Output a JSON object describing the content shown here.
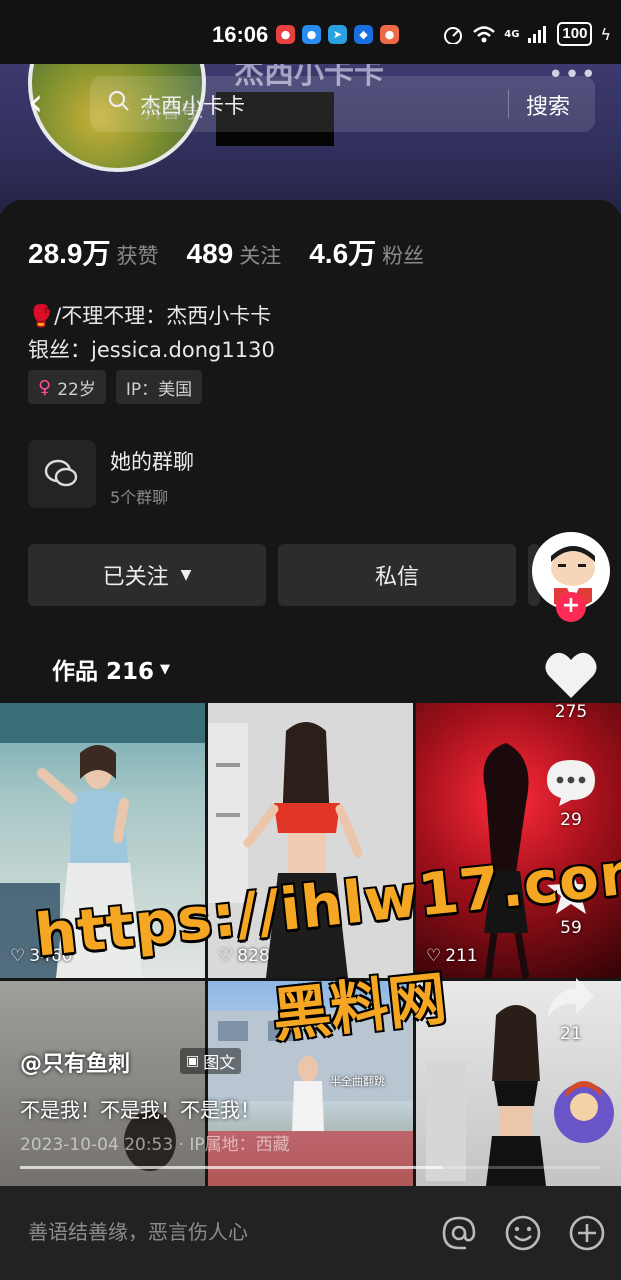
{
  "status": {
    "time": "16:06",
    "network": "4G",
    "battery": "100"
  },
  "header": {
    "profile_name": "杰西小卡卡",
    "search_text": "杰西小卡卡",
    "douyin_id_label": "抖音号:",
    "search_button": "搜索"
  },
  "stats": [
    {
      "value": "28.9万",
      "label": "获赞"
    },
    {
      "value": "489",
      "label": "关注"
    },
    {
      "value": "4.6万",
      "label": "粉丝"
    }
  ],
  "bio": {
    "line1": "🥊/不理不理：杰西小卡卡",
    "line2": "银丝：jessica.dong1130"
  },
  "tags": {
    "age": "22岁",
    "ip": "IP：美国"
  },
  "group": {
    "title": "她的群聊",
    "subtitle": "5个群聊"
  },
  "buttons": {
    "followed": "已关注",
    "message": "私信"
  },
  "works": {
    "label": "作品 216"
  },
  "tiles": [
    {
      "count": "3460"
    },
    {
      "count": "828"
    },
    {
      "count": "211"
    }
  ],
  "tile_texts": {
    "banner": "半全曲翻跳"
  },
  "rail": {
    "likes": "275",
    "comments": "29",
    "favorites": "59",
    "shares": "21"
  },
  "overlay": {
    "author": "@只有鱼刺",
    "chip": "图文",
    "caption": "不是我！不是我！不是我！",
    "meta": "2023-10-04 20:53 · IP属地：西藏",
    "progress": 0.73
  },
  "watermark": {
    "url": "https://ihlw17.com",
    "name": "黑料网"
  },
  "comment_bar": {
    "placeholder": "善语结善缘，恶言伤人心"
  },
  "colors": {
    "accent": "#fe2c55",
    "watermark": "#f5a623",
    "background": "#161616"
  }
}
